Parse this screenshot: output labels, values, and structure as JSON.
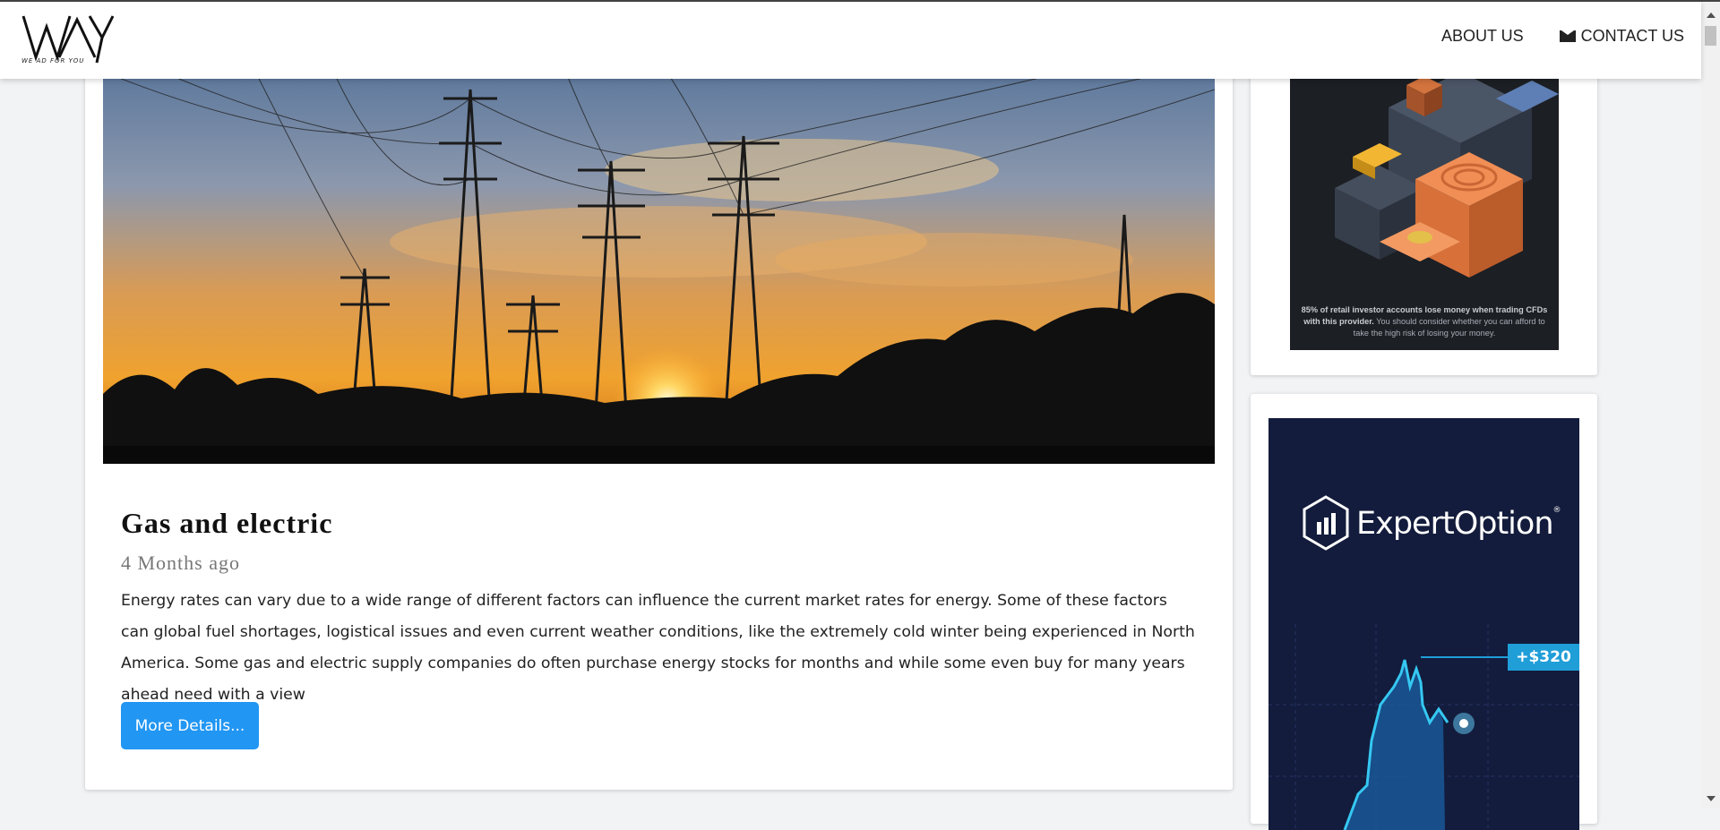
{
  "nav": {
    "logo_text": "WAY",
    "logo_tagline": "WE AD FOR YOU",
    "links": [
      {
        "label": "ABOUT US"
      },
      {
        "label": "CONTACT US",
        "icon": "envelope-icon"
      }
    ]
  },
  "post": {
    "image_alt": "Power lines at sunset",
    "title": "Gas and electric",
    "date": "4 Months ago",
    "excerpt": "Energy rates can vary due to a wide range of different factors can influence the current market rates for energy. Some of these factors can global fuel shortages, logistical issues and even current weather conditions, like the extremely cold winter being experienced in North America. Some gas and electric supply companies do often purchase energy stocks for months and while some even buy for many years ahead need with a view",
    "button_label": "More Details..."
  },
  "ads": {
    "trading_disclaimer_bold": "85% of retail investor accounts lose money when trading CFDs with this provider.",
    "trading_disclaimer": " You should consider whether you can afford to take the high risk of losing your money.",
    "expert_brand": "ExpertOption",
    "expert_badge": "+$320"
  },
  "colors": {
    "accent": "#2196f3",
    "page_bg": "#f1f3f5"
  }
}
